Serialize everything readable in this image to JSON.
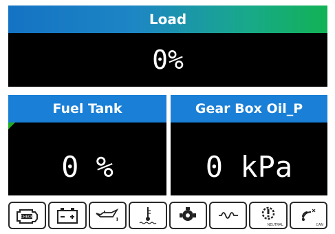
{
  "load": {
    "title": "Load",
    "value": "0%"
  },
  "fuel_tank": {
    "title": "Fuel Tank",
    "value": "0 %"
  },
  "gear_box": {
    "title": "Gear Box Oil_P",
    "value": "0 kPa"
  },
  "warning_icons": [
    {
      "name": "check-engine-icon",
      "label": "CHECK"
    },
    {
      "name": "battery-icon",
      "label": ""
    },
    {
      "name": "oil-pressure-icon",
      "label": ""
    },
    {
      "name": "coolant-temperature-icon",
      "label": ""
    },
    {
      "name": "transmission-icon",
      "label": ""
    },
    {
      "name": "glow-plug-icon",
      "label": ""
    },
    {
      "name": "neutral-icon",
      "label": "NEUTRAL"
    },
    {
      "name": "can-icon",
      "label": "CAN"
    }
  ]
}
